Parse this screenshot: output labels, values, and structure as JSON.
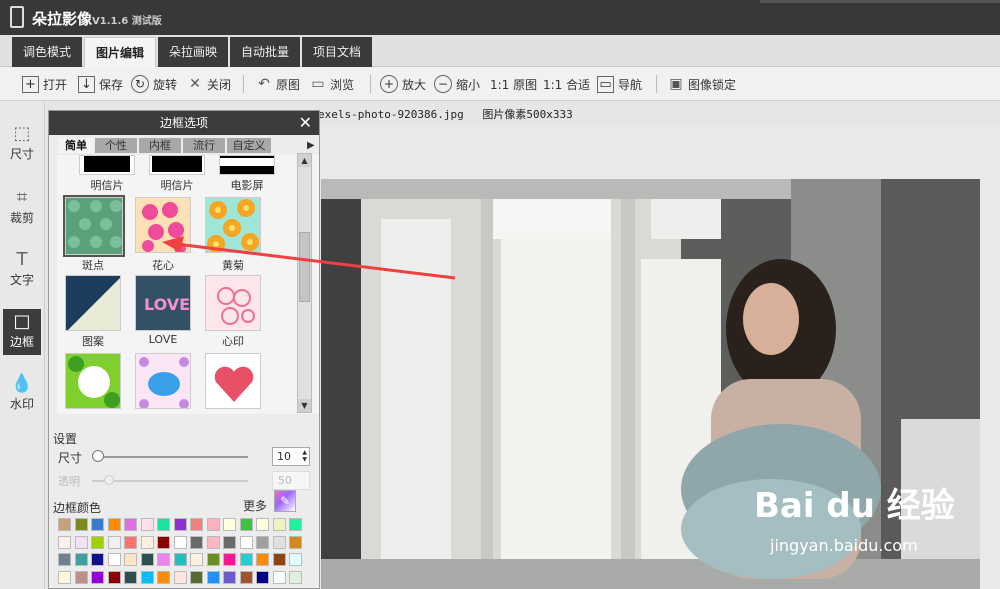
{
  "app": {
    "title": "朵拉影像",
    "version": "V1.1.6 测试版"
  },
  "tabs": [
    {
      "label": "调色模式"
    },
    {
      "label": "图片编辑"
    },
    {
      "label": "朵拉画映"
    },
    {
      "label": "自动批量"
    },
    {
      "label": "项目文档"
    }
  ],
  "toolbar": {
    "open": "打开",
    "save": "保存",
    "rotate": "旋转",
    "close": "关闭",
    "original": "原图",
    "browse": "浏览",
    "zoom_in": "放大",
    "zoom_out": "缩小",
    "one_to_one_original": "1:1 原图",
    "one_to_one_fit": "1:1 合适",
    "navigator": "导航",
    "lock": "图像锁定"
  },
  "sidebar": [
    {
      "label": "尺寸",
      "icon": "resize-icon"
    },
    {
      "label": "裁剪",
      "icon": "crop-icon"
    },
    {
      "label": "文字",
      "icon": "text-icon"
    },
    {
      "label": "边框",
      "icon": "frame-icon"
    },
    {
      "label": "水印",
      "icon": "watermark-icon"
    }
  ],
  "file": {
    "name": "exels-photo-920386.jpg",
    "pixels": "图片像素500x333"
  },
  "dialog": {
    "title": "边框选项",
    "subtabs": [
      "简单",
      "个性",
      "内框",
      "流行",
      "自定义"
    ],
    "thumbs": [
      {
        "label": "明信片"
      },
      {
        "label": "明信片"
      },
      {
        "label": "电影屏"
      },
      {
        "label": "斑点"
      },
      {
        "label": "花心"
      },
      {
        "label": "黄菊"
      },
      {
        "label": "图案"
      },
      {
        "label": "LOVE"
      },
      {
        "label": "心印"
      }
    ],
    "settings_title": "设置",
    "size_label": "尺寸",
    "size_value": "10",
    "opacity_label": "透明",
    "opacity_value": "50",
    "color_label": "边框颜色",
    "more_label": "更多",
    "colors": [
      "#c8a07a",
      "#7a8a20",
      "#3a7ac8",
      "#ff8c00",
      "#e070e0",
      "#ffe0e8",
      "#20e0a0",
      "#9030d0",
      "#f08080",
      "#ffb0c0",
      "#ffffe0",
      "#40c040",
      "#ffffe0",
      "#f0f0c0",
      "#20f0a0",
      "#fff0f0",
      "#f0e0f8",
      "#a0d000",
      "#f0f0f0",
      "#ff7070",
      "#fff0e0",
      "#8b0000",
      "#ffffff",
      "#6a6a6a",
      "#ffb6c1",
      "#6a6a6a",
      "#ffffff",
      "#a0a0a0",
      "#e0e0e0",
      "#d08a20",
      "#708090",
      "#40a0a0",
      "#10108a",
      "#ffffff",
      "#ffe4c4",
      "#2f4f4f",
      "#ee82ee",
      "#20c0c0",
      "#fff0e0",
      "#6b8e23",
      "#ff1493",
      "#20d0d0",
      "#ff8c00",
      "#8b4513",
      "#e0ffff",
      "#fff8dc",
      "#bc8f8f",
      "#9400d3",
      "#8b0000",
      "#2f4f4f",
      "#00bfff",
      "#ff8c00",
      "#ffe4e1",
      "#556b2f",
      "#1e90ff",
      "#6a5acd",
      "#a0522d",
      "#00008b",
      "#f5fffa",
      "#e0f0e0"
    ]
  },
  "watermark": {
    "brand": "Bai du 经验",
    "url": "jingyan.baidu.com"
  }
}
